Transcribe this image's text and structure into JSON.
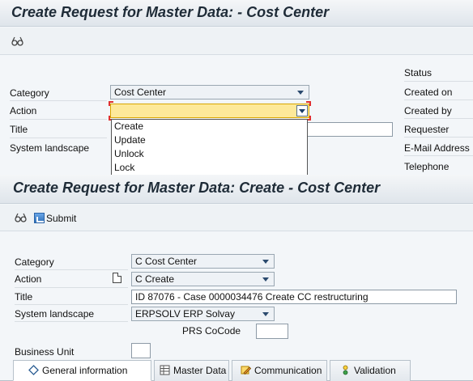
{
  "top_window": {
    "title": "Create Request for Master Data:  - Cost Center",
    "glasses_icon": "display-change-icon",
    "fields": {
      "category": {
        "label": "Category",
        "value": "Cost Center"
      },
      "action": {
        "label": "Action",
        "value": ""
      },
      "title": {
        "label": "Title"
      },
      "system_landscape": {
        "label": "System landscape"
      }
    },
    "dropdown_options": [
      "Create",
      "Update",
      "Unlock",
      "Lock"
    ],
    "right_labels": [
      "Status",
      "Created on",
      "Created by",
      "Requester",
      "E-Mail Address",
      "Telephone"
    ]
  },
  "bottom_window": {
    "title": "Create Request for Master Data: Create - Cost Center",
    "toolbar": {
      "submit_label": "Submit"
    },
    "fields": {
      "category": {
        "label": "Category",
        "value": "C Cost Center"
      },
      "action": {
        "label": "Action",
        "value": "C Create"
      },
      "title": {
        "label": "Title",
        "value": "ID 87076 - Case 0000034476 Create CC restructuring"
      },
      "system_landscape": {
        "label": "System landscape",
        "value": "ERPSOLV ERP Solvay"
      },
      "prs_cocode": {
        "label": "PRS CoCode",
        "value": ""
      },
      "business_unit": {
        "label": "Business Unit",
        "value": ""
      }
    },
    "tabs": [
      {
        "label": "General information",
        "icon": "diamond-icon"
      },
      {
        "label": "Master Data",
        "icon": "grid-icon"
      },
      {
        "label": "Communication",
        "icon": "edit-pencil-icon"
      },
      {
        "label": "Validation",
        "icon": "validation-icon"
      }
    ]
  }
}
